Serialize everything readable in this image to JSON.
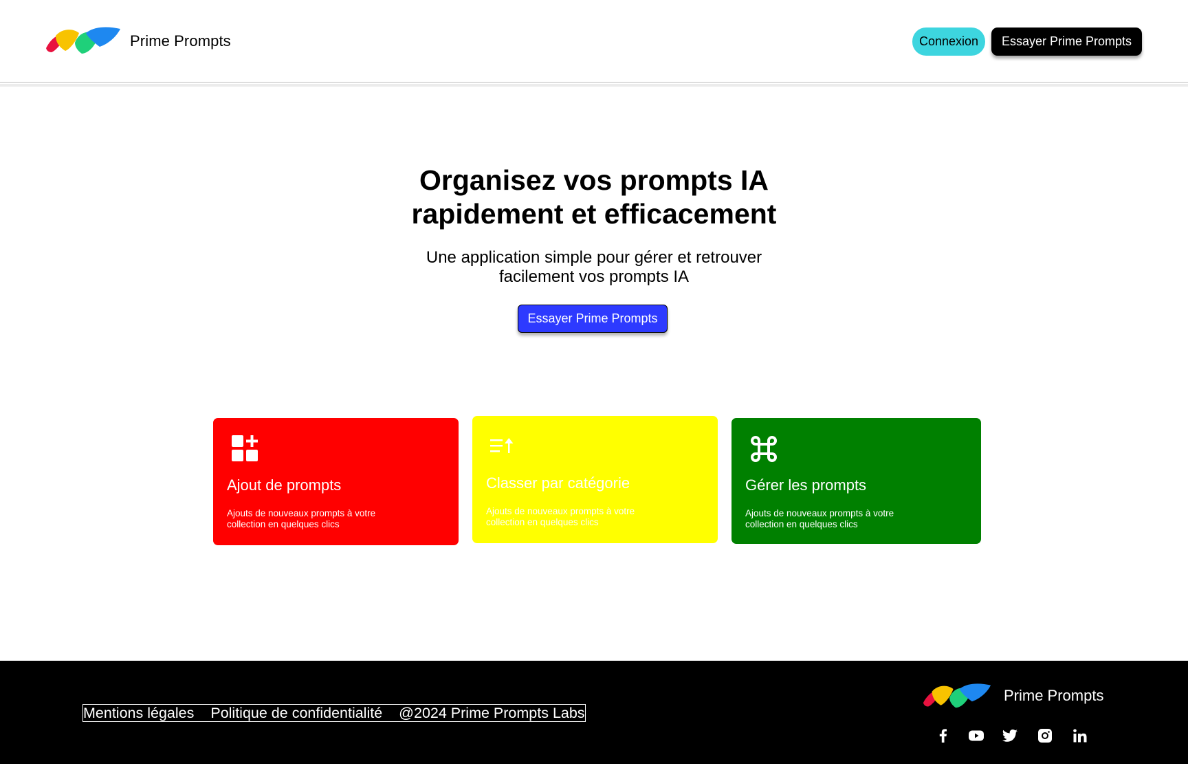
{
  "header": {
    "brand": "Prime Prompts",
    "login_label": "Connexion",
    "try_label": "Essayer Prime Prompts"
  },
  "hero": {
    "title_line1": "Organisez vos prompts IA",
    "title_line2": "rapidement et efficacement",
    "subtitle_line1": "Une application simple pour gérer et retrouver",
    "subtitle_line2": "facilement vos prompts IA",
    "cta_label": "Essayer Prime Prompts"
  },
  "features": [
    {
      "title": "Ajout de prompts",
      "desc_line1": "Ajouts de nouveaux prompts à votre",
      "desc_line2": "collection en quelques clics",
      "color": "#ff0000",
      "icon": "grid-plus-icon"
    },
    {
      "title": "Classer par catégorie",
      "desc_line1": "Ajouts de nouveaux prompts à votre",
      "desc_line2": "collection en quelques clics",
      "color": "#ffff00",
      "icon": "sort-ascending-icon"
    },
    {
      "title": "Gérer les prompts",
      "desc_line1": "Ajouts de nouveaux prompts à votre",
      "desc_line2": "collection en quelques clics",
      "color": "#008000",
      "icon": "command-icon"
    }
  ],
  "footer": {
    "links": [
      "Mentions légales",
      "Politique de confidentialité",
      "@2024 Prime Prompts Labs"
    ],
    "brand": "Prime Prompts",
    "socials": [
      "facebook-icon",
      "youtube-icon",
      "twitter-icon",
      "instagram-icon",
      "linkedin-icon"
    ]
  },
  "colors": {
    "login_button": "#3dd5df",
    "cta_button": "#2d3aff",
    "logo_red": "#e8123f",
    "logo_yellow": "#f8c300",
    "logo_green": "#1fd07a",
    "logo_blue": "#1e88f0"
  }
}
